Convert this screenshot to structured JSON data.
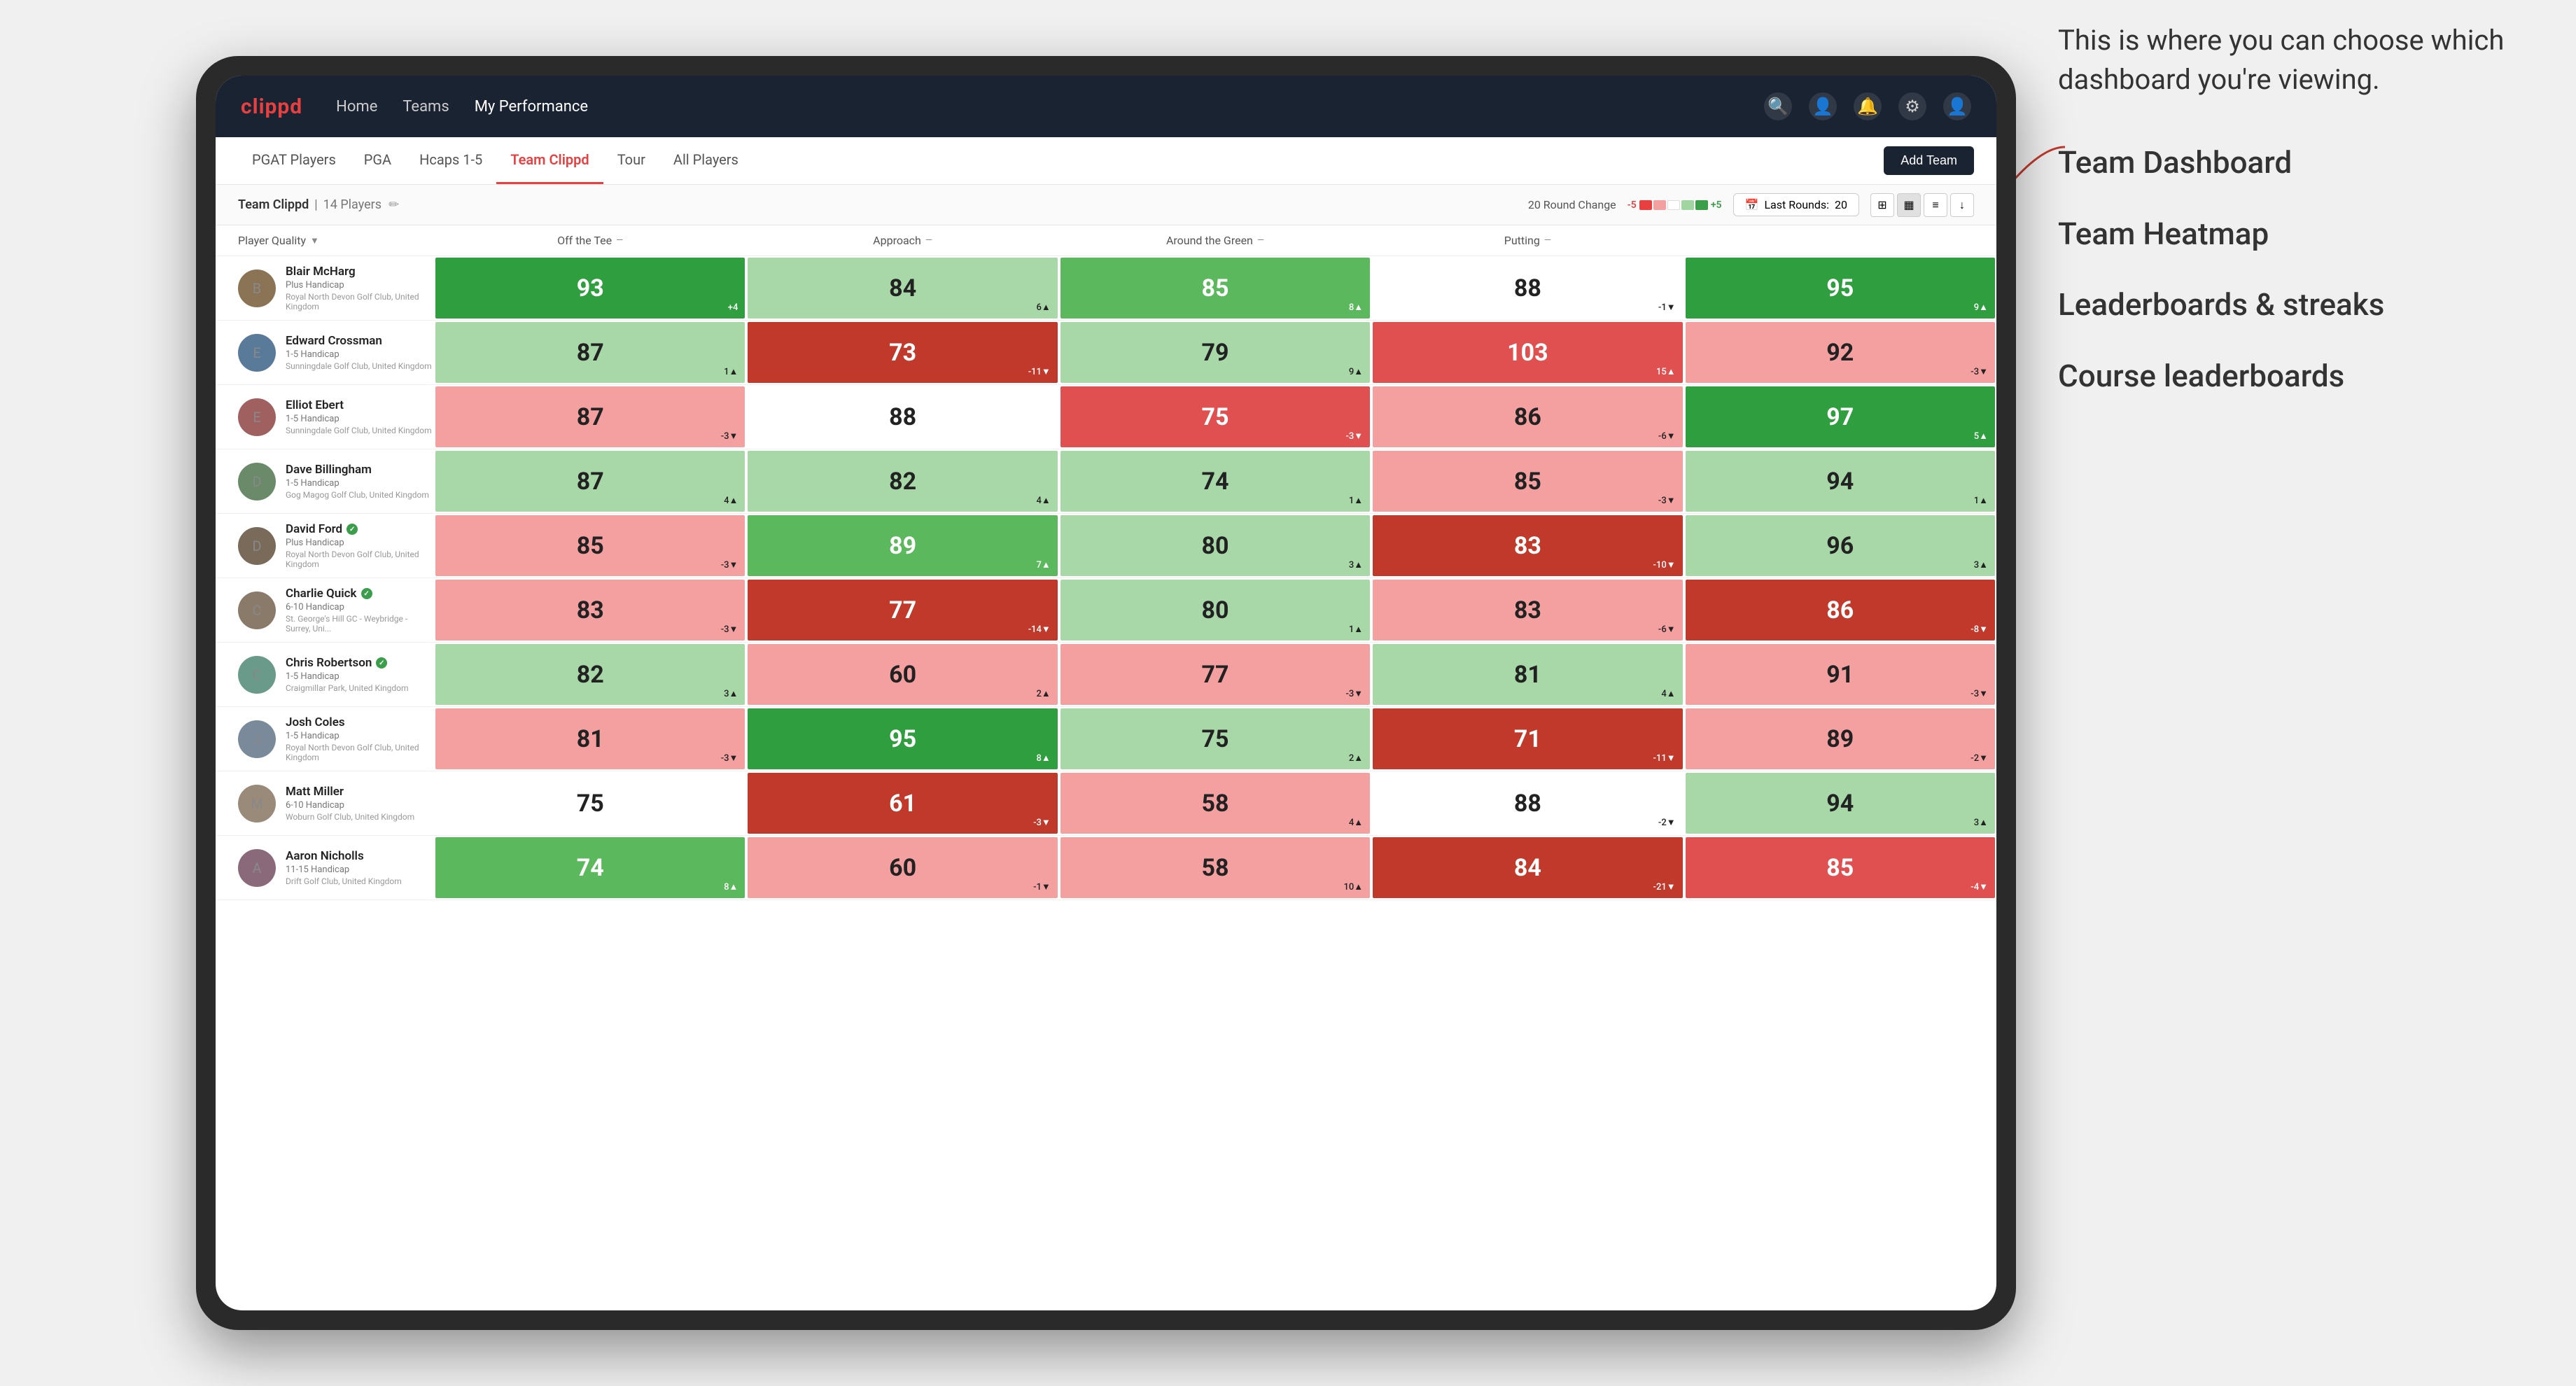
{
  "annotation": {
    "intro": "This is where you can choose which dashboard you're viewing.",
    "items": [
      "Team Dashboard",
      "Team Heatmap",
      "Leaderboards & streaks",
      "Course leaderboards"
    ]
  },
  "nav": {
    "logo": "clippd",
    "links": [
      {
        "label": "Home",
        "active": false
      },
      {
        "label": "Teams",
        "active": false
      },
      {
        "label": "My Performance",
        "active": true
      }
    ],
    "icons": [
      "search",
      "person",
      "notifications",
      "settings",
      "profile"
    ]
  },
  "sub_nav": {
    "items": [
      {
        "label": "PGAT Players",
        "active": false
      },
      {
        "label": "PGA",
        "active": false
      },
      {
        "label": "Hcaps 1-5",
        "active": false
      },
      {
        "label": "Team Clippd",
        "active": true
      },
      {
        "label": "Tour",
        "active": false
      },
      {
        "label": "All Players",
        "active": false
      }
    ],
    "add_team_label": "Add Team"
  },
  "team_bar": {
    "team_name": "Team Clippd",
    "separator": "|",
    "player_count": "14 Players",
    "round_change_label": "20 Round Change",
    "range_neg": "-5",
    "range_pos": "+5",
    "last_rounds_label": "Last Rounds:",
    "last_rounds_value": "20"
  },
  "table": {
    "columns": [
      {
        "label": "Player Quality",
        "sortable": true
      },
      {
        "label": "Off the Tee",
        "sortable": true
      },
      {
        "label": "Approach",
        "sortable": true
      },
      {
        "label": "Around the Green",
        "sortable": true
      },
      {
        "label": "Putting",
        "sortable": true
      }
    ],
    "players": [
      {
        "name": "Blair McHarg",
        "handicap": "Plus Handicap",
        "club": "Royal North Devon Golf Club, United Kingdom",
        "verified": false,
        "avatar_color": "#8B7355",
        "scores": [
          {
            "value": 93,
            "change": "+4",
            "dir": "up",
            "bg": "green-strong",
            "text": "white"
          },
          {
            "value": 84,
            "change": "6▲",
            "dir": "up",
            "bg": "green-light",
            "text": "dark"
          },
          {
            "value": 85,
            "change": "8▲",
            "dir": "up",
            "bg": "green-mid",
            "text": "white"
          },
          {
            "value": 88,
            "change": "-1▼",
            "dir": "down",
            "bg": "white-cell",
            "text": "dark"
          },
          {
            "value": 95,
            "change": "9▲",
            "dir": "up",
            "bg": "green-strong",
            "text": "white"
          }
        ]
      },
      {
        "name": "Edward Crossman",
        "handicap": "1-5 Handicap",
        "club": "Sunningdale Golf Club, United Kingdom",
        "verified": false,
        "avatar_color": "#5a7a9a",
        "scores": [
          {
            "value": 87,
            "change": "1▲",
            "dir": "up",
            "bg": "green-light",
            "text": "dark"
          },
          {
            "value": 73,
            "change": "-11▼",
            "dir": "down",
            "bg": "red-strong",
            "text": "white"
          },
          {
            "value": 79,
            "change": "9▲",
            "dir": "up",
            "bg": "green-light",
            "text": "dark"
          },
          {
            "value": 103,
            "change": "15▲",
            "dir": "up",
            "bg": "red-mid",
            "text": "white"
          },
          {
            "value": 92,
            "change": "-3▼",
            "dir": "down",
            "bg": "red-light",
            "text": "dark"
          }
        ]
      },
      {
        "name": "Elliot Ebert",
        "handicap": "1-5 Handicap",
        "club": "Sunningdale Golf Club, United Kingdom",
        "verified": false,
        "avatar_color": "#a06060",
        "scores": [
          {
            "value": 87,
            "change": "-3▼",
            "dir": "down",
            "bg": "red-light",
            "text": "dark"
          },
          {
            "value": 88,
            "change": "",
            "dir": "none",
            "bg": "white-cell",
            "text": "dark"
          },
          {
            "value": 75,
            "change": "-3▼",
            "dir": "down",
            "bg": "red-mid",
            "text": "white"
          },
          {
            "value": 86,
            "change": "-6▼",
            "dir": "down",
            "bg": "red-light",
            "text": "dark"
          },
          {
            "value": 97,
            "change": "5▲",
            "dir": "up",
            "bg": "green-strong",
            "text": "white"
          }
        ]
      },
      {
        "name": "Dave Billingham",
        "handicap": "1-5 Handicap",
        "club": "Gog Magog Golf Club, United Kingdom",
        "verified": false,
        "avatar_color": "#6a8a6a",
        "scores": [
          {
            "value": 87,
            "change": "4▲",
            "dir": "up",
            "bg": "green-light",
            "text": "dark"
          },
          {
            "value": 82,
            "change": "4▲",
            "dir": "up",
            "bg": "green-light",
            "text": "dark"
          },
          {
            "value": 74,
            "change": "1▲",
            "dir": "up",
            "bg": "green-light",
            "text": "dark"
          },
          {
            "value": 85,
            "change": "-3▼",
            "dir": "down",
            "bg": "red-light",
            "text": "dark"
          },
          {
            "value": 94,
            "change": "1▲",
            "dir": "up",
            "bg": "green-light",
            "text": "dark"
          }
        ]
      },
      {
        "name": "David Ford",
        "handicap": "Plus Handicap",
        "club": "Royal North Devon Golf Club, United Kingdom",
        "verified": true,
        "avatar_color": "#7a6a5a",
        "scores": [
          {
            "value": 85,
            "change": "-3▼",
            "dir": "down",
            "bg": "red-light",
            "text": "dark"
          },
          {
            "value": 89,
            "change": "7▲",
            "dir": "up",
            "bg": "green-mid",
            "text": "white"
          },
          {
            "value": 80,
            "change": "3▲",
            "dir": "up",
            "bg": "green-light",
            "text": "dark"
          },
          {
            "value": 83,
            "change": "-10▼",
            "dir": "down",
            "bg": "red-strong",
            "text": "white"
          },
          {
            "value": 96,
            "change": "3▲",
            "dir": "up",
            "bg": "green-light",
            "text": "dark"
          }
        ]
      },
      {
        "name": "Charlie Quick",
        "handicap": "6-10 Handicap",
        "club": "St. George's Hill GC - Weybridge - Surrey, Uni...",
        "verified": true,
        "avatar_color": "#8a7a6a",
        "scores": [
          {
            "value": 83,
            "change": "-3▼",
            "dir": "down",
            "bg": "red-light",
            "text": "dark"
          },
          {
            "value": 77,
            "change": "-14▼",
            "dir": "down",
            "bg": "red-strong",
            "text": "white"
          },
          {
            "value": 80,
            "change": "1▲",
            "dir": "up",
            "bg": "green-light",
            "text": "dark"
          },
          {
            "value": 83,
            "change": "-6▼",
            "dir": "down",
            "bg": "red-light",
            "text": "dark"
          },
          {
            "value": 86,
            "change": "-8▼",
            "dir": "down",
            "bg": "red-strong",
            "text": "white"
          }
        ]
      },
      {
        "name": "Chris Robertson",
        "handicap": "1-5 Handicap",
        "club": "Craigmillar Park, United Kingdom",
        "verified": true,
        "avatar_color": "#6a9a8a",
        "scores": [
          {
            "value": 82,
            "change": "3▲",
            "dir": "up",
            "bg": "green-light",
            "text": "dark"
          },
          {
            "value": 60,
            "change": "2▲",
            "dir": "up",
            "bg": "red-light",
            "text": "dark"
          },
          {
            "value": 77,
            "change": "-3▼",
            "dir": "down",
            "bg": "red-light",
            "text": "dark"
          },
          {
            "value": 81,
            "change": "4▲",
            "dir": "up",
            "bg": "green-light",
            "text": "dark"
          },
          {
            "value": 91,
            "change": "-3▼",
            "dir": "down",
            "bg": "red-light",
            "text": "dark"
          }
        ]
      },
      {
        "name": "Josh Coles",
        "handicap": "1-5 Handicap",
        "club": "Royal North Devon Golf Club, United Kingdom",
        "verified": false,
        "avatar_color": "#7a8a9a",
        "scores": [
          {
            "value": 81,
            "change": "-3▼",
            "dir": "down",
            "bg": "red-light",
            "text": "dark"
          },
          {
            "value": 95,
            "change": "8▲",
            "dir": "up",
            "bg": "green-strong",
            "text": "white"
          },
          {
            "value": 75,
            "change": "2▲",
            "dir": "up",
            "bg": "green-light",
            "text": "dark"
          },
          {
            "value": 71,
            "change": "-11▼",
            "dir": "down",
            "bg": "red-strong",
            "text": "white"
          },
          {
            "value": 89,
            "change": "-2▼",
            "dir": "down",
            "bg": "red-light",
            "text": "dark"
          }
        ]
      },
      {
        "name": "Matt Miller",
        "handicap": "6-10 Handicap",
        "club": "Woburn Golf Club, United Kingdom",
        "verified": false,
        "avatar_color": "#9a8a7a",
        "scores": [
          {
            "value": 75,
            "change": "",
            "dir": "none",
            "bg": "white-cell",
            "text": "dark"
          },
          {
            "value": 61,
            "change": "-3▼",
            "dir": "down",
            "bg": "red-strong",
            "text": "white"
          },
          {
            "value": 58,
            "change": "4▲",
            "dir": "up",
            "bg": "red-light",
            "text": "dark"
          },
          {
            "value": 88,
            "change": "-2▼",
            "dir": "down",
            "bg": "white-cell",
            "text": "dark"
          },
          {
            "value": 94,
            "change": "3▲",
            "dir": "up",
            "bg": "green-light",
            "text": "dark"
          }
        ]
      },
      {
        "name": "Aaron Nicholls",
        "handicap": "11-15 Handicap",
        "club": "Drift Golf Club, United Kingdom",
        "verified": false,
        "avatar_color": "#8a6a7a",
        "scores": [
          {
            "value": 74,
            "change": "8▲",
            "dir": "up",
            "bg": "green-mid",
            "text": "white"
          },
          {
            "value": 60,
            "change": "-1▼",
            "dir": "down",
            "bg": "red-light",
            "text": "dark"
          },
          {
            "value": 58,
            "change": "10▲",
            "dir": "up",
            "bg": "red-light",
            "text": "dark"
          },
          {
            "value": 84,
            "change": "-21▼",
            "dir": "down",
            "bg": "red-strong",
            "text": "white"
          },
          {
            "value": 85,
            "change": "-4▼",
            "dir": "down",
            "bg": "red-mid",
            "text": "white"
          }
        ]
      }
    ]
  }
}
